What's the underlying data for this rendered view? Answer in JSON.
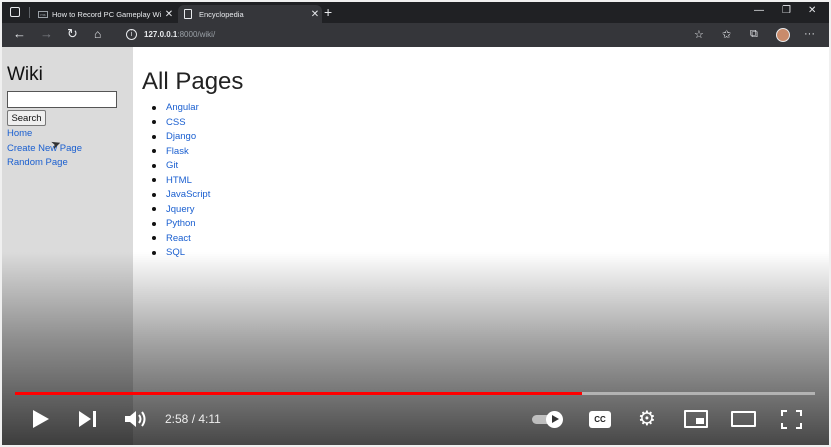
{
  "browser": {
    "tabs": [
      {
        "title": "How to Record PC Gameplay Wi",
        "favicon": "ms",
        "active": false
      },
      {
        "title": "Encyclopedia",
        "favicon": "document-icon",
        "active": true
      }
    ],
    "new_tab": "+",
    "window_controls": [
      "—",
      "❐",
      "✕"
    ],
    "url_host": "127.0.0.1",
    "url_path": ":8000/wiki/"
  },
  "sidebar": {
    "title": "Wiki",
    "search_value": "",
    "search_button": "Search",
    "links": [
      "Home",
      "Create New Page",
      "Random Page"
    ]
  },
  "main": {
    "heading": "All Pages",
    "pages": [
      "Angular",
      "CSS",
      "Django",
      "Flask",
      "Git",
      "HTML",
      "JavaScript",
      "Jquery",
      "Python",
      "React",
      "SQL"
    ]
  },
  "player": {
    "current_time": "2:58",
    "duration": "4:11",
    "progress_fraction": 0.709,
    "cc_label": "CC",
    "accent": "#ff0000"
  },
  "colors": {
    "link": "#1a5fd0",
    "sidebar_bg": "#dbdbdb",
    "browser_dark": "#202124"
  }
}
